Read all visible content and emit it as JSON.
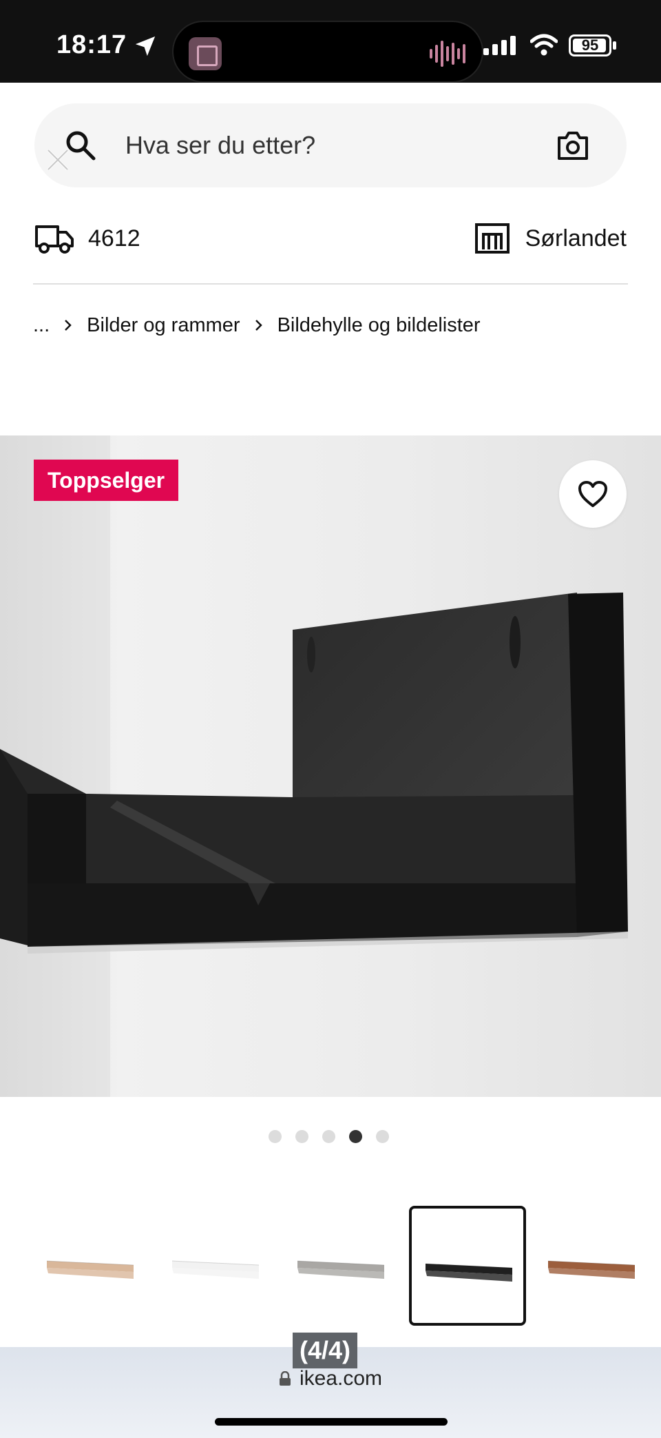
{
  "status_bar": {
    "time": "18:17",
    "battery_percent": "95",
    "battery_level": 0.95,
    "icons": [
      "location-arrow-icon",
      "app-activity-icon",
      "audio-wave-icon",
      "cellular-signal-icon",
      "wifi-icon",
      "battery-icon"
    ]
  },
  "search": {
    "placeholder": "Hva ser du etter?",
    "icon": "search-icon",
    "camera_icon": "camera-icon"
  },
  "delivery": {
    "postcode": "4612",
    "icon": "truck-icon"
  },
  "store": {
    "name": "Sørlandet",
    "icon": "store-icon"
  },
  "breadcrumb": {
    "ellipsis": "...",
    "items": [
      "Bilder og rammer",
      "Bildehylle og bildelister"
    ]
  },
  "product": {
    "badge": "Toppselger",
    "favorite_icon": "heart-icon"
  },
  "carousel": {
    "total": 5,
    "active_index": 3
  },
  "thumbnails": [
    {
      "color": "#d9b79a",
      "selected": false
    },
    {
      "color": "#f2f2f2",
      "selected": false
    },
    {
      "color": "#a9a7a4",
      "selected": false
    },
    {
      "color": "#1f1f1f",
      "selected": true
    },
    {
      "color": "#9c5e3c",
      "selected": false
    }
  ],
  "browser": {
    "page_count": "(4/4)",
    "url": "ikea.com"
  },
  "colors": {
    "badge": "#e00751",
    "search_bg": "#f5f5f5",
    "status_bar": "#111111"
  }
}
